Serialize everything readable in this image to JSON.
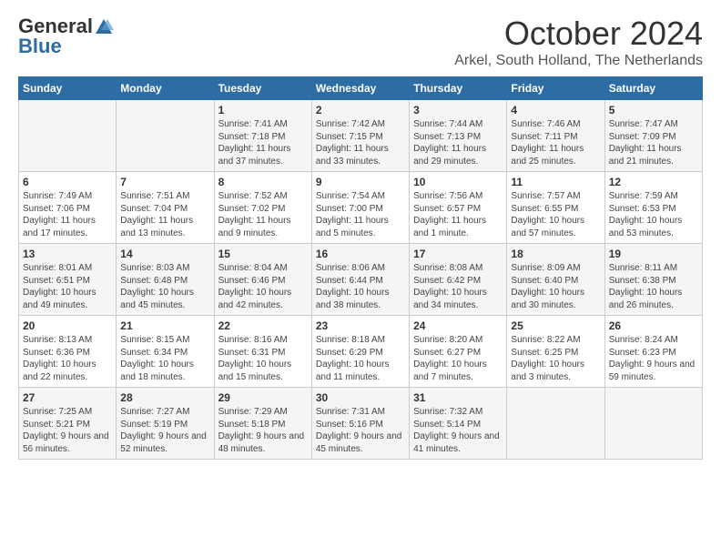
{
  "header": {
    "logo_general": "General",
    "logo_blue": "Blue",
    "month": "October 2024",
    "location": "Arkel, South Holland, The Netherlands"
  },
  "days_of_week": [
    "Sunday",
    "Monday",
    "Tuesday",
    "Wednesday",
    "Thursday",
    "Friday",
    "Saturday"
  ],
  "weeks": [
    [
      {
        "day": "",
        "content": ""
      },
      {
        "day": "",
        "content": ""
      },
      {
        "day": "1",
        "content": "Sunrise: 7:41 AM\nSunset: 7:18 PM\nDaylight: 11 hours and 37 minutes."
      },
      {
        "day": "2",
        "content": "Sunrise: 7:42 AM\nSunset: 7:15 PM\nDaylight: 11 hours and 33 minutes."
      },
      {
        "day": "3",
        "content": "Sunrise: 7:44 AM\nSunset: 7:13 PM\nDaylight: 11 hours and 29 minutes."
      },
      {
        "day": "4",
        "content": "Sunrise: 7:46 AM\nSunset: 7:11 PM\nDaylight: 11 hours and 25 minutes."
      },
      {
        "day": "5",
        "content": "Sunrise: 7:47 AM\nSunset: 7:09 PM\nDaylight: 11 hours and 21 minutes."
      }
    ],
    [
      {
        "day": "6",
        "content": "Sunrise: 7:49 AM\nSunset: 7:06 PM\nDaylight: 11 hours and 17 minutes."
      },
      {
        "day": "7",
        "content": "Sunrise: 7:51 AM\nSunset: 7:04 PM\nDaylight: 11 hours and 13 minutes."
      },
      {
        "day": "8",
        "content": "Sunrise: 7:52 AM\nSunset: 7:02 PM\nDaylight: 11 hours and 9 minutes."
      },
      {
        "day": "9",
        "content": "Sunrise: 7:54 AM\nSunset: 7:00 PM\nDaylight: 11 hours and 5 minutes."
      },
      {
        "day": "10",
        "content": "Sunrise: 7:56 AM\nSunset: 6:57 PM\nDaylight: 11 hours and 1 minute."
      },
      {
        "day": "11",
        "content": "Sunrise: 7:57 AM\nSunset: 6:55 PM\nDaylight: 10 hours and 57 minutes."
      },
      {
        "day": "12",
        "content": "Sunrise: 7:59 AM\nSunset: 6:53 PM\nDaylight: 10 hours and 53 minutes."
      }
    ],
    [
      {
        "day": "13",
        "content": "Sunrise: 8:01 AM\nSunset: 6:51 PM\nDaylight: 10 hours and 49 minutes."
      },
      {
        "day": "14",
        "content": "Sunrise: 8:03 AM\nSunset: 6:48 PM\nDaylight: 10 hours and 45 minutes."
      },
      {
        "day": "15",
        "content": "Sunrise: 8:04 AM\nSunset: 6:46 PM\nDaylight: 10 hours and 42 minutes."
      },
      {
        "day": "16",
        "content": "Sunrise: 8:06 AM\nSunset: 6:44 PM\nDaylight: 10 hours and 38 minutes."
      },
      {
        "day": "17",
        "content": "Sunrise: 8:08 AM\nSunset: 6:42 PM\nDaylight: 10 hours and 34 minutes."
      },
      {
        "day": "18",
        "content": "Sunrise: 8:09 AM\nSunset: 6:40 PM\nDaylight: 10 hours and 30 minutes."
      },
      {
        "day": "19",
        "content": "Sunrise: 8:11 AM\nSunset: 6:38 PM\nDaylight: 10 hours and 26 minutes."
      }
    ],
    [
      {
        "day": "20",
        "content": "Sunrise: 8:13 AM\nSunset: 6:36 PM\nDaylight: 10 hours and 22 minutes."
      },
      {
        "day": "21",
        "content": "Sunrise: 8:15 AM\nSunset: 6:34 PM\nDaylight: 10 hours and 18 minutes."
      },
      {
        "day": "22",
        "content": "Sunrise: 8:16 AM\nSunset: 6:31 PM\nDaylight: 10 hours and 15 minutes."
      },
      {
        "day": "23",
        "content": "Sunrise: 8:18 AM\nSunset: 6:29 PM\nDaylight: 10 hours and 11 minutes."
      },
      {
        "day": "24",
        "content": "Sunrise: 8:20 AM\nSunset: 6:27 PM\nDaylight: 10 hours and 7 minutes."
      },
      {
        "day": "25",
        "content": "Sunrise: 8:22 AM\nSunset: 6:25 PM\nDaylight: 10 hours and 3 minutes."
      },
      {
        "day": "26",
        "content": "Sunrise: 8:24 AM\nSunset: 6:23 PM\nDaylight: 9 hours and 59 minutes."
      }
    ],
    [
      {
        "day": "27",
        "content": "Sunrise: 7:25 AM\nSunset: 5:21 PM\nDaylight: 9 hours and 56 minutes."
      },
      {
        "day": "28",
        "content": "Sunrise: 7:27 AM\nSunset: 5:19 PM\nDaylight: 9 hours and 52 minutes."
      },
      {
        "day": "29",
        "content": "Sunrise: 7:29 AM\nSunset: 5:18 PM\nDaylight: 9 hours and 48 minutes."
      },
      {
        "day": "30",
        "content": "Sunrise: 7:31 AM\nSunset: 5:16 PM\nDaylight: 9 hours and 45 minutes."
      },
      {
        "day": "31",
        "content": "Sunrise: 7:32 AM\nSunset: 5:14 PM\nDaylight: 9 hours and 41 minutes."
      },
      {
        "day": "",
        "content": ""
      },
      {
        "day": "",
        "content": ""
      }
    ]
  ]
}
